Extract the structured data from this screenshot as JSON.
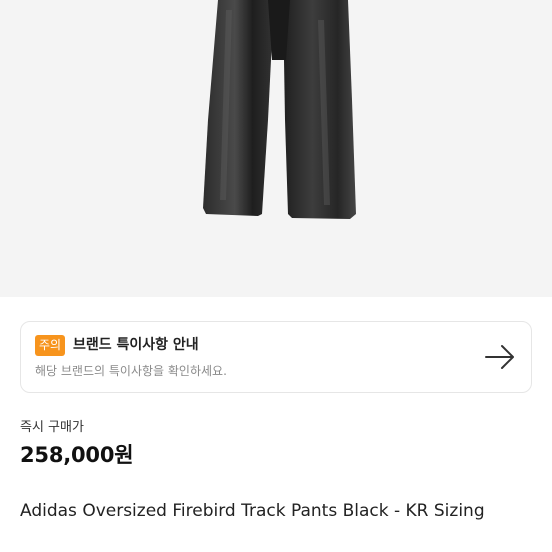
{
  "notice": {
    "badge": "주의",
    "title": "브랜드 특이사항 안내",
    "subtitle": "해당 브랜드의 특이사항을 확인하세요."
  },
  "price": {
    "label": "즉시 구매가",
    "value": "258,000원"
  },
  "product": {
    "title": "Adidas Oversized Firebird Track Pants Black - KR Sizing"
  },
  "icons": {
    "notice_arrow": "arrow-right-icon"
  }
}
